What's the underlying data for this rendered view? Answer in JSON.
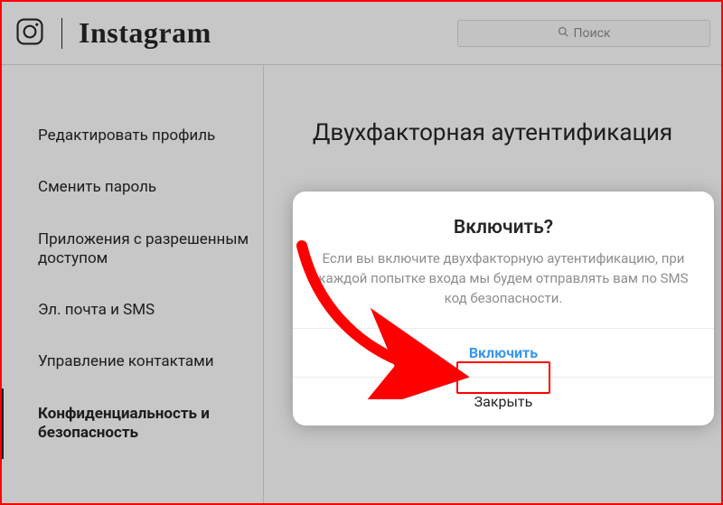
{
  "header": {
    "wordmark": "Instagram",
    "search_placeholder": "Поиск"
  },
  "sidebar": {
    "items": [
      {
        "label": "Редактировать профиль"
      },
      {
        "label": "Сменить пароль"
      },
      {
        "label": "Приложения с разрешенным доступом"
      },
      {
        "label": "Эл. почта и SMS"
      },
      {
        "label": "Управление контактами"
      },
      {
        "label": "Конфиденциальность и безопасность"
      }
    ],
    "active_index": 5
  },
  "main": {
    "title": "Двухфакторная аутентификация"
  },
  "modal": {
    "title": "Включить?",
    "description": "Если вы включите двухфакторную аутентификацию, при каждой попытке входа мы будем отправлять вам по SMS код безопасности.",
    "primary_label": "Включить",
    "secondary_label": "Закрыть"
  }
}
